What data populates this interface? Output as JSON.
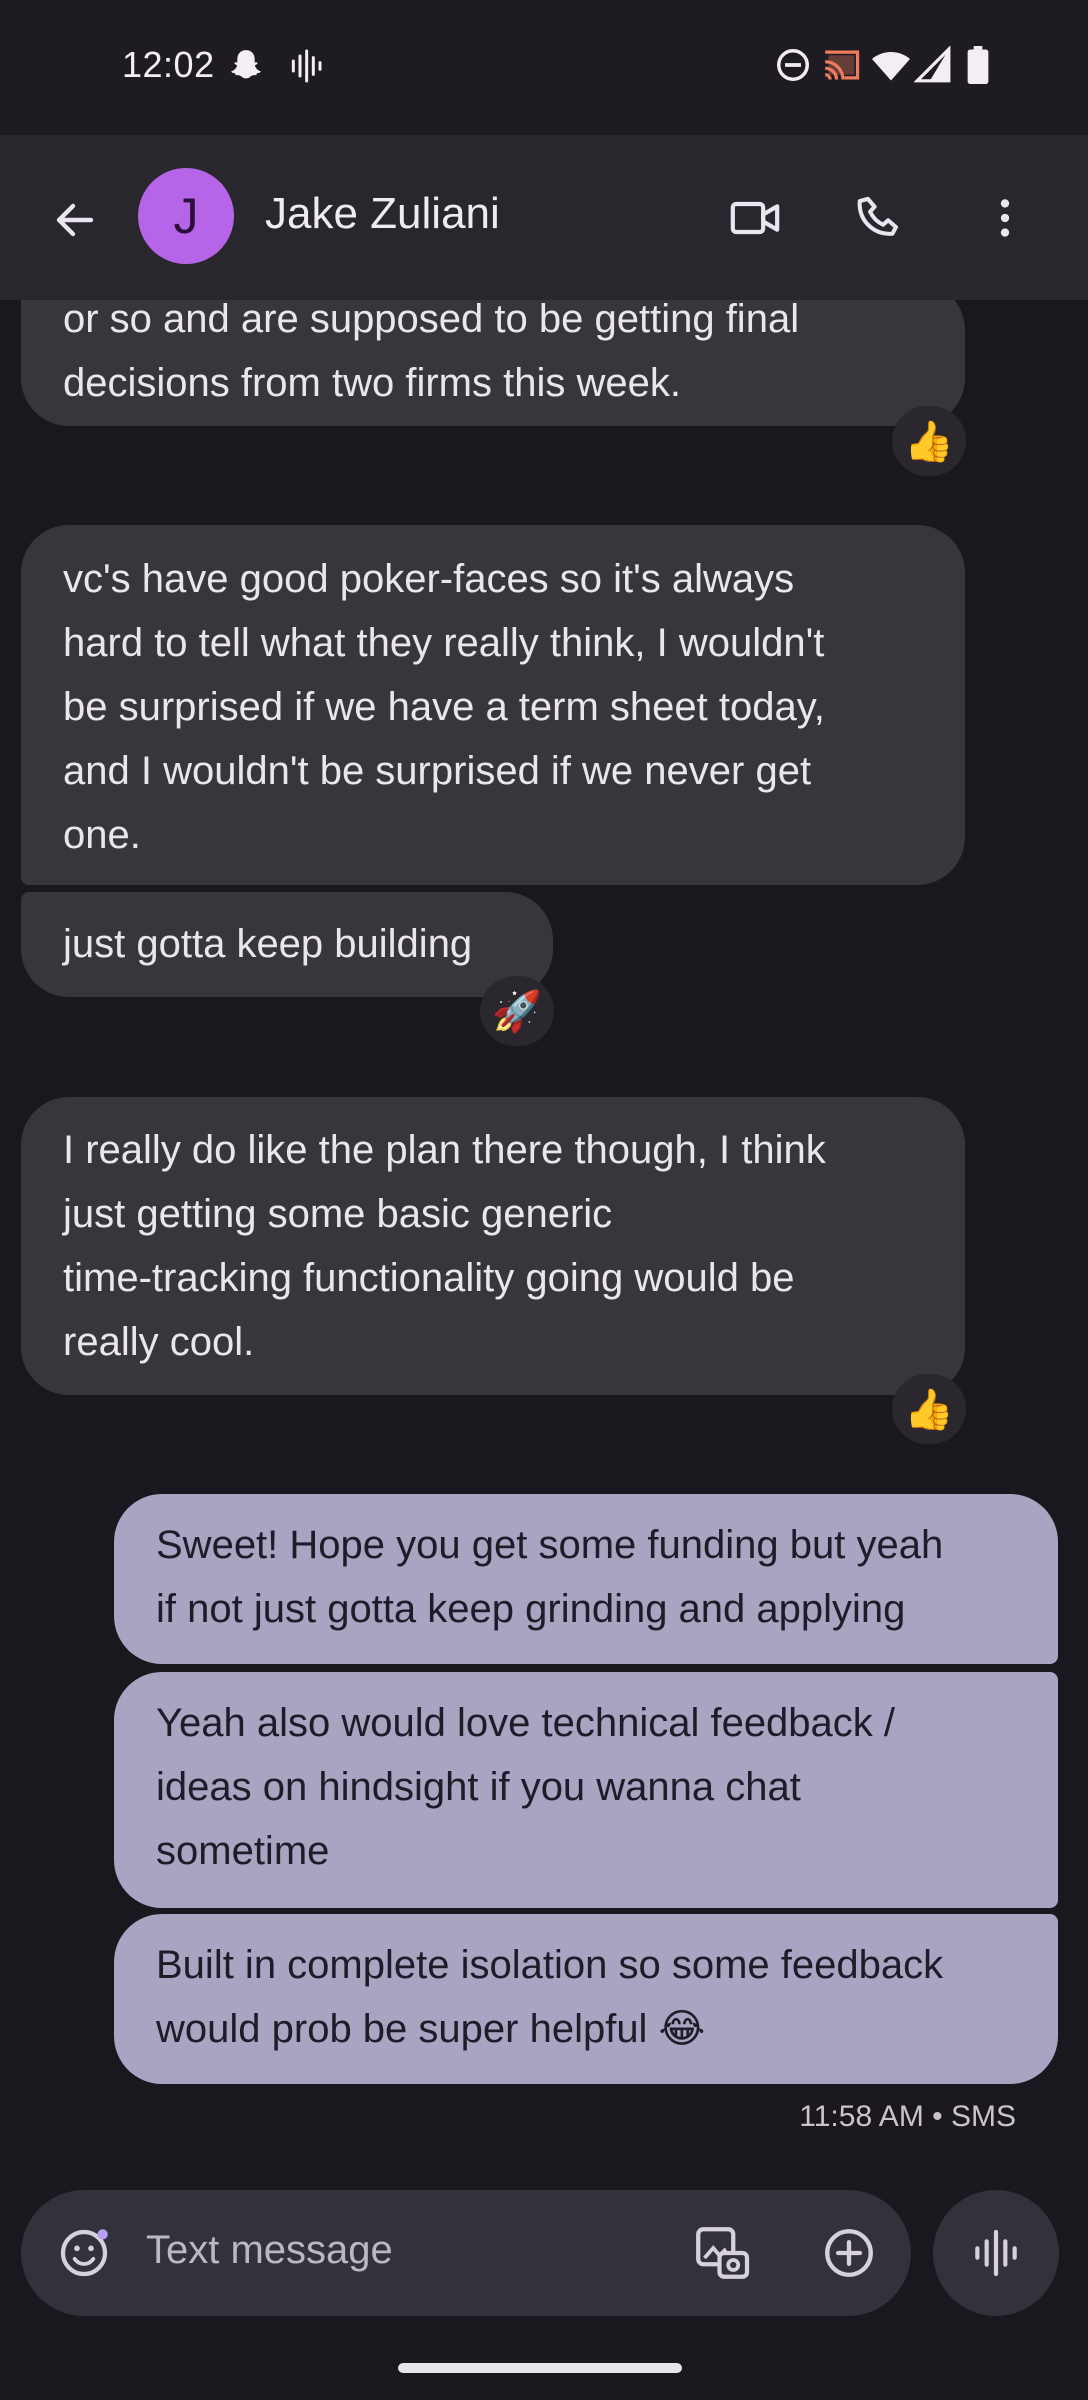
{
  "status_bar": {
    "time": "12:02",
    "left_icons": [
      "snapchat-icon",
      "voice-wave-icon"
    ],
    "right_icons": [
      "do-not-disturb-icon",
      "cast-icon",
      "wifi-icon",
      "signal-icon",
      "battery-icon"
    ]
  },
  "header": {
    "avatar_initial": "J",
    "contact_name": "Jake Zuliani",
    "actions": [
      "video-call",
      "phone-call",
      "more-options"
    ]
  },
  "messages": [
    {
      "direction": "incoming",
      "lines": [
        "or so and are supposed to be getting final",
        "decisions from two firms this week."
      ],
      "reaction": "👍"
    },
    {
      "direction": "incoming",
      "lines": [
        "vc's have good poker-faces so it's always",
        "hard to tell what they really think, I wouldn't",
        "be surprised if we have a term sheet today,",
        "and I wouldn't be surprised if we never get",
        "one."
      ]
    },
    {
      "direction": "incoming",
      "lines": [
        "just gotta keep building"
      ],
      "reaction": "🚀"
    },
    {
      "direction": "incoming",
      "lines": [
        "I really do like the plan there though, I think",
        "just getting some basic generic",
        "time-tracking functionality going would be",
        "really cool."
      ],
      "reaction": "👍"
    },
    {
      "direction": "outgoing",
      "lines": [
        "Sweet! Hope you get some funding but yeah",
        "if not just gotta keep grinding and applying"
      ]
    },
    {
      "direction": "outgoing",
      "lines": [
        "Yeah also would love technical feedback /",
        "ideas on hindsight if you wanna chat",
        "sometime"
      ]
    },
    {
      "direction": "outgoing",
      "lines": [
        "Built in complete isolation so some feedback",
        "would prob be super helpful 😂"
      ]
    }
  ],
  "timestamp": "11:58 AM • SMS",
  "composer": {
    "placeholder": "Text message"
  },
  "colors": {
    "background": "#1a181e",
    "incoming_bubble": "#38363d",
    "outgoing_bubble": "#a9a4c2",
    "avatar": "#b765e8"
  }
}
